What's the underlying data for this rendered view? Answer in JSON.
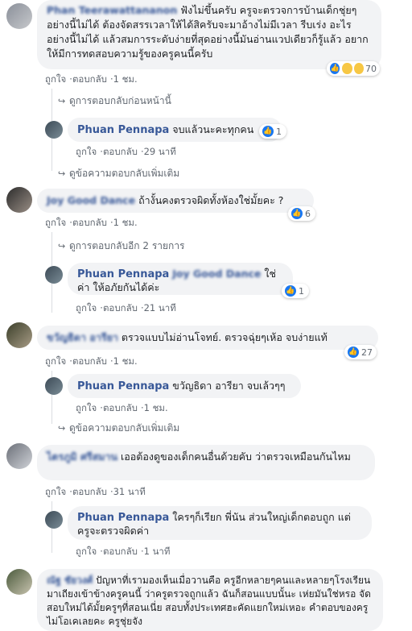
{
  "colors": {
    "link": "#385898",
    "bubble": "#f2f3f5",
    "meta": "#606770",
    "like": "#1877f2"
  },
  "actions": {
    "like": "ถูกใจ",
    "reply": "ตอบกลับ",
    "sep": "·"
  },
  "comments": [
    {
      "author": "Phan Teerawattananon",
      "text": "ฟังไม่ขึ้นครับ ครูจะตรวจการบ้านเด็กชุ่ยๆ อย่างนี้ไม่ได้ ต้องจัดสรรเวลาให้ได้สิครับจะมาอ้างไม่มีเวลา รีบเร่ง อะไรอย่างนี้ไม่ได้ แล้วสมการระดับง่ายที่สุดอย่างนี้มันอ่านแวปเดียวก็รู้แล้ว อยากให้มีการทดสอบความรู้ของครูคนนี้ครับ",
      "reactions": "70",
      "time": "1 ชม.",
      "prev_replies": "ดูการตอบกลับก่อนหน้านี้",
      "reply": {
        "author": "Phuan Pennapa",
        "text": "จบแล้วนะคะทุกคน",
        "reactions": "1",
        "time": "29 นาที"
      },
      "more": "ดูข้อความตอบกลับเพิ่มเติม"
    },
    {
      "author": "Joy Good Dance",
      "text": "ถ้างั้นคงตรวจผิดทั้งห้องใช่มั้ยคะ ?",
      "reactions": "6",
      "time": "1 ชม.",
      "more": "ดูการตอบกลับอีก 2 รายการ",
      "reply": {
        "author": "Phuan Pennapa",
        "mention": "Joy Good Dance",
        "text": "ใช่ค่า ให้อภัยกันได้ค่ะ",
        "reactions": "1",
        "time": "21 นาที"
      }
    },
    {
      "author": "ขวัญธิดา อารียา",
      "text": "ตรวจแบบไม่อ่านโจทย์. ตรวจฉุ่ยๆเห้อ จบง่ายแท้",
      "reactions": "27",
      "time": "1 ชม.",
      "reply": {
        "author": "Phuan Pennapa",
        "text": "ขวัญธิดา อารียา จบเล้วๆๆ",
        "time": "1 ชม."
      },
      "more": "ดูข้อความตอบกลับเพิ่มเติม"
    },
    {
      "author": "ไตรภูมิ ศรีสมาน",
      "text": "เออต้องดูของเด็กคนอื่นด้วยคับ ว่าตรวจเหมือนกันไหม",
      "time": "31 นาที",
      "reply": {
        "author": "Phuan Pennapa",
        "text": "ใครๆก็เรียก พี่นัน ส่วนใหญ่เด็กตอบถูก แต่ครูจะตรวจผิดค่า",
        "time": "1 นาที"
      }
    },
    {
      "author": "ณัฐ ชัยวงศ์",
      "text": "ปัญหาที่เรามองเห็นเมื่อวานคือ ครูอีกหลายๆคนและหลายๆโรงเรียนมาเถียงเข้าข้างครูคนนี้ ว่าครูตรวจถูกแล้ว ฉันก็สอนแบบนั้นะ เห่ยมันใช่หรอ จัดสอบใหม่ได้มั้ยครูๆที่สอนเนี่ย สอบทั้งประเทศฮะคัดแยกใหม่เหอะ คำตอบของครูไม่โอเคเลยคะ ครูชุ่ยจัง"
    }
  ]
}
